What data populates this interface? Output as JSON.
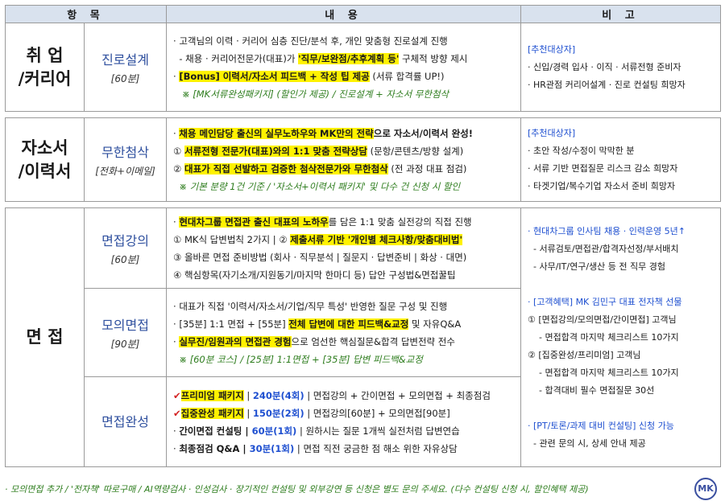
{
  "header": {
    "col1": "항 목",
    "col2": "내 용",
    "col3": "비 고"
  },
  "career": {
    "category": "취 업\n/커리어",
    "cat_line1": "취 업",
    "cat_line2": "/커리어",
    "sub_title": "진로설계",
    "sub_duration": "[60분]",
    "lines": [
      "· 고객님의 이력 · 커리어 심층 진단/분석 후, 개인 맞춤형 진로설계 진행",
      "- 채용 · 커리어전문가(대표)가 ",
      "'직무/보완점/추후계획 등'",
      " 구체적 방향 제시",
      "· ",
      "[Bonus] 이력서/자소서 피드백 + 작성 팁 제공",
      " (서류 합격률 UP!)",
      "※ [MK서류완성패키지] (할인가 제공) / 진로설계 + 자소서 무한첨삭"
    ],
    "note_title": "[추천대상자]",
    "notes": [
      "· 신입/경력 입사 · 이직 · 서류전형 준비자",
      "· HR관점 커리어설계 · 진로 컨설팅 희망자"
    ]
  },
  "resume": {
    "cat_line1": "자소서",
    "cat_line2": "/이력서",
    "sub_title": "무한첨삭",
    "sub_duration": "[전화+이메일]",
    "l1_pre": "· ",
    "l1_hl": "채용 메인담당 출신의 실무노하우와 MK만의 전략",
    "l1_post": "으로 자소서/이력서 완성!",
    "l2_pre": "① ",
    "l2_hl": "서류전형 전문가(대표)와의 1:1 맞춤 전략상담",
    "l2_post": " (문항/콘텐츠/방향 설계)",
    "l3_pre": "② ",
    "l3_hl": "대표가 직접 선발하고 검증한 첨삭전문가와 무한첨삭",
    "l3_post": " (전 과정 대표 점검)",
    "l4": "※ 기본 분량 1건 기준 / '자소서+이력서 패키지' 및 다수 건 신청 시 할인",
    "note_title": "[추천대상자]",
    "notes": [
      "· 초안 작성/수정이 막막한 분",
      "· 서류 기반 면접질문 리스크 감소 희망자",
      "· 타겟기업/복수기업 자소서 준비 희망자"
    ]
  },
  "interview": {
    "category": "면 접",
    "lecture": {
      "sub_title": "면접강의",
      "sub_duration": "[60분]",
      "l1_pre": "· ",
      "l1_hl": "현대차그룹 면접관 출신 대표의 노하우",
      "l1_post": "를 담은 1:1 맞춤 실전강의 직접 진행",
      "l2_pre": "① MK식 답변법칙 2가지  |  ② ",
      "l2_hl": "제출서류 기반 '개인별 체크사항/맞춤대비법'",
      "l3": "③ 올바른 면접 준비방법 (회사 · 직무분석 | 질문지 · 답변준비 | 화상 · 대면)",
      "l4": "④ 핵심항목(자기소개/지원동기/마지막 한마디 등) 답안 구성법&면접꿀팁"
    },
    "mock": {
      "sub_title": "모의면접",
      "sub_duration": "[90분]",
      "l1": "· 대표가 직접 '이력서/자소서/기업/직무 특성' 반영한 질문 구성 및 진행",
      "l2_pre": "· [35분] 1:1 면접 + [55분] ",
      "l2_hl": "전체 답변에 대한 피드백&교정",
      "l2_post": " 및 자유Q&A",
      "l3_pre": "· ",
      "l3_hl": "실무진/임원과의 면접관 경험",
      "l3_post": "으로 엄선한 핵심질문&합격 답변전략 전수",
      "l4": "※ [60분 코스] / [25분] 1:1면접 + [35분] 답변 피드백&교정"
    },
    "complete": {
      "sub_title": "면접완성",
      "rows": [
        {
          "mark": "✔",
          "name": "프리미엄 패키지",
          "time": "240분(4회)",
          "desc": " | 면접강의 + 간이면접 + 모의면접 + 최종점검"
        },
        {
          "mark": "✔",
          "name": "집중완성 패키지",
          "time": "150분(2회)",
          "desc": " | 면접강의[60분] + 모의면접[90분]"
        },
        {
          "mark": "· ",
          "name": "간이면접 컨설팅 | ",
          "time": "60분(1회)",
          "desc": " | 원하시는 질문 1개씩 실전처럼 답변연습"
        },
        {
          "mark": "· ",
          "name": "최종점검 Q&A  | ",
          "time": "30분(1회)",
          "desc": " | 면접 직전 궁금한 점 해소 위한 자유상담"
        }
      ]
    },
    "notes": {
      "n1": "· 현대차그룹 인사팀 채용 · 인력운영 5년↑",
      "n2": "- 서류검토/면접관/합격자선정/부서배치",
      "n3": "- 사무/IT/연구/생산 등 전 직무 경험",
      "n4": "· [고객혜택] MK 김민구 대표 전자책 선물",
      "n5": "① [면접강의/모의면접/간이면접] 고객님",
      "n6": "- 면접합격 마지막 체크리스트 10가지",
      "n7": "② [집중완성/프리미엄] 고객님",
      "n8": "- 면접합격 마지막 체크리스트 10가지",
      "n9": "- 합격대비 필수 면접질문 30선",
      "n10": "· [PT/토론/과제 대비 컨설팅] 신청 가능",
      "n11": "- 관련 문의 시, 상세 안내 제공"
    }
  },
  "footer": "· 모의면접 추가 / '전자책' 따로구매 / AI역량검사 · 인성검사 · 장기적인 컨설팅 및 외부강연 등 신청은 별도 문의 주세요. (다수 컨설팅 신청 시, 할인혜택 제공)",
  "logo": "MK",
  "colors": {
    "header_bg": "#d9e2ee",
    "highlight": "#fff200",
    "accent_blue": "#1e4fd0",
    "note_green": "#2e7d1e",
    "check_red": "#d32222"
  }
}
